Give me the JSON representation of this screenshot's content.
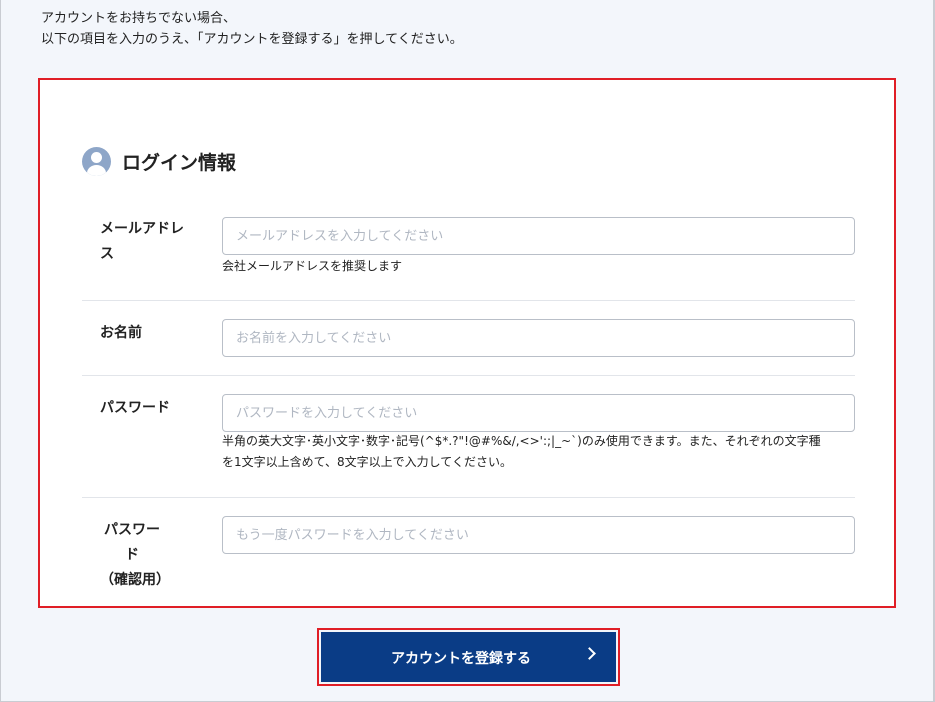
{
  "intro": {
    "line1": "アカウントをお持ちでない場合、",
    "line2": "以下の項目を入力のうえ、「アカウントを登録する」を押してください。"
  },
  "section": {
    "title": "ログイン情報",
    "icon": "user-icon"
  },
  "fields": {
    "email": {
      "label_line1": "メールアドレ",
      "label_line2": "ス",
      "placeholder": "メールアドレスを入力してください",
      "value": "",
      "note": "会社メールアドレスを推奨します"
    },
    "name": {
      "label": "お名前",
      "placeholder": "お名前を入力してください",
      "value": ""
    },
    "password": {
      "label": "パスワード",
      "placeholder": "パスワードを入力してください",
      "value": "",
      "note_line1": "半角の英大文字･英小文字･数字･記号(^$*.?\"!@#%&/,<>':;|_~`)のみ使用できます。また、それぞれの文字種",
      "note_line2": "を1文字以上含めて、8文字以上で入力してください。"
    },
    "password_confirm": {
      "label_line1": "パスワード",
      "label_line2": "（確認用）",
      "placeholder": "もう一度パスワードを入力してください",
      "value": ""
    }
  },
  "submit": {
    "label": "アカウントを登録する",
    "icon": "chevron-right-icon"
  },
  "colors": {
    "accent_button": "#0a3c86",
    "highlight_border": "#e01e26",
    "page_background": "#f3f6fb",
    "user_icon": "#8ea6c8"
  }
}
